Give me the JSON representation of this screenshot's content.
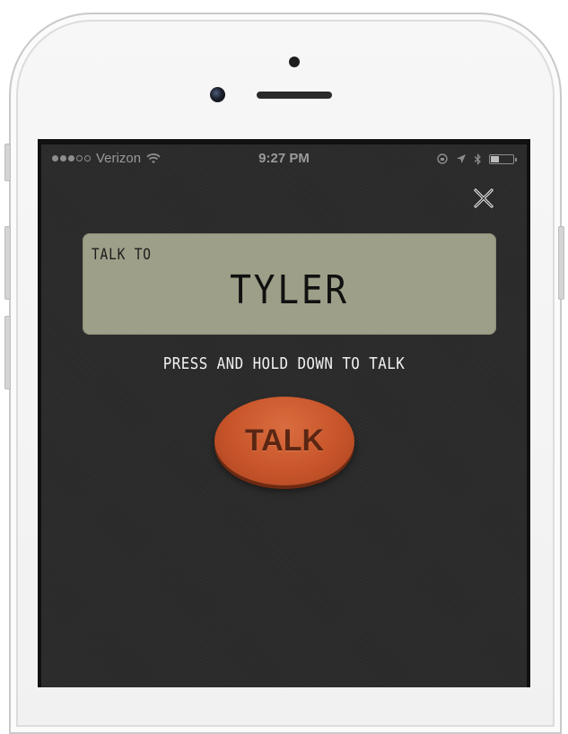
{
  "status_bar": {
    "carrier": "Verizon",
    "time": "9:27 PM",
    "signal_bars_filled": 3,
    "signal_bars_total": 5,
    "battery_level": 0.35
  },
  "header": {
    "close_icon": "close-x-icon"
  },
  "lcd_display": {
    "label": "TALK TO",
    "contact_name": "TYLER",
    "background_color": "#9d9f88"
  },
  "instruction": "PRESS AND HOLD DOWN TO TALK",
  "talk_button": {
    "label": "TALK",
    "color": "#c8552a"
  }
}
